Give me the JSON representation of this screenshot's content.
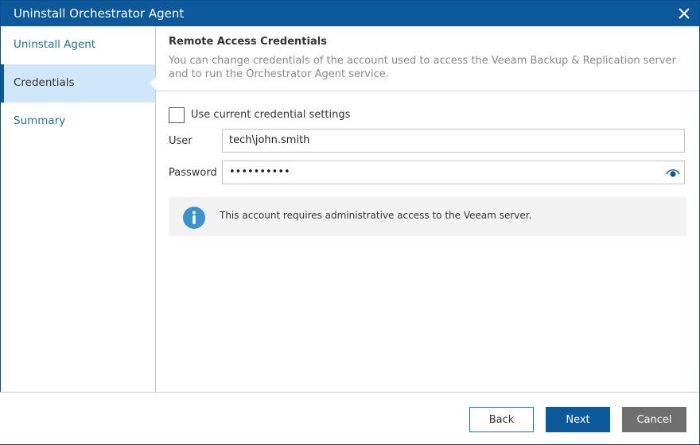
{
  "window": {
    "title": "Uninstall Orchestrator Agent",
    "close_icon": "close-icon"
  },
  "sidebar": {
    "items": [
      {
        "label": "Uninstall Agent",
        "active": false
      },
      {
        "label": "Credentials",
        "active": true
      },
      {
        "label": "Summary",
        "active": false
      }
    ]
  },
  "header": {
    "title": "Remote Access Credentials",
    "description": "You can change credentials of the account used to access the Veeam Backup & Replication server and to run the Orchestrator Agent service."
  },
  "form": {
    "use_current": {
      "label": "Use current credential settings",
      "checked": false
    },
    "user": {
      "label": "User",
      "value": "tech\\john.smith"
    },
    "password": {
      "label": "Password",
      "value": "••••••••••",
      "reveal_icon": "eye-icon"
    }
  },
  "info": {
    "icon": "info-icon",
    "text": "This account requires administrative access to the Veeam server."
  },
  "footer": {
    "back_label": "Back",
    "next_label": "Next",
    "cancel_label": "Cancel"
  },
  "colors": {
    "accent": "#0c5a9c",
    "link": "#1f6fb2",
    "active_nav_bg": "#cfe7fb",
    "info_icon": "#3a93cf"
  }
}
